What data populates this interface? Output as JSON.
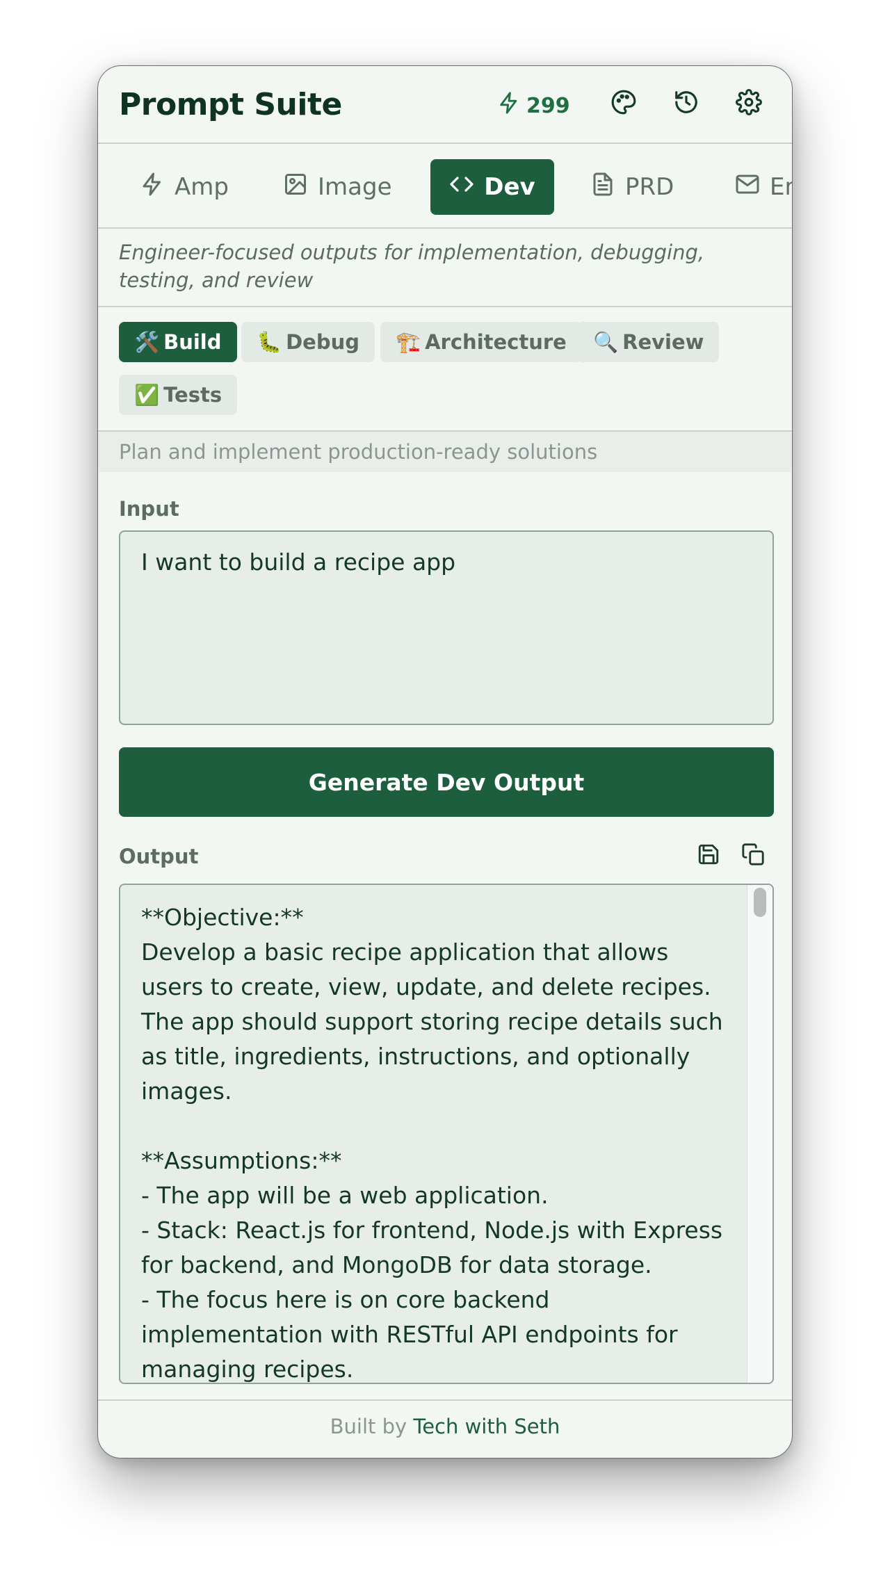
{
  "header": {
    "title": "Prompt Suite",
    "credits": "299",
    "credits_icon": "bolt-icon",
    "buttons": [
      "palette-icon",
      "history-icon",
      "settings-icon"
    ]
  },
  "tabs": [
    {
      "label": "Amp",
      "icon": "bolt-icon",
      "active": false
    },
    {
      "label": "Image",
      "icon": "image-icon",
      "active": false
    },
    {
      "label": "Dev",
      "icon": "code-icon",
      "active": true
    },
    {
      "label": "PRD",
      "icon": "document-icon",
      "active": false
    },
    {
      "label": "Email",
      "icon": "mail-icon",
      "active": false
    }
  ],
  "description": "Engineer-focused outputs for implementation, debugging, testing, and review",
  "modes": [
    {
      "emoji": "🛠️",
      "label": "Build",
      "active": true
    },
    {
      "emoji": "🐛",
      "label": "Debug",
      "active": false
    },
    {
      "emoji": "🏗️",
      "label": "Architecture",
      "active": false
    },
    {
      "emoji": "🔍",
      "label": "Review",
      "active": false
    },
    {
      "emoji": "✅",
      "label": "Tests",
      "active": false
    }
  ],
  "mode_hint": "Plan and implement production-ready solutions",
  "input": {
    "label": "Input",
    "value": "I want to build a recipe app"
  },
  "generate_button": "Generate Dev Output",
  "output": {
    "label": "Output",
    "actions": [
      "save-icon",
      "copy-icon"
    ],
    "text": "**Objective:**\nDevelop a basic recipe application that allows users to create, view, update, and delete recipes. The app should support storing recipe details such as title, ingredients, instructions, and optionally images.\n\n**Assumptions:**\n- The app will be a web application.\n- Stack: React.js for frontend, Node.js with Express for backend, and MongoDB for data storage.\n- The focus here is on core backend implementation with RESTful API endpoints for managing recipes.\n- Authentication is not included in this initial"
  },
  "footer": {
    "prefix": "Built by",
    "link": "Tech with Seth"
  },
  "colors": {
    "accent": "#1c5e3e",
    "background": "#f3f7f4",
    "field": "#e7eeea",
    "credits": "#1e6f42"
  }
}
